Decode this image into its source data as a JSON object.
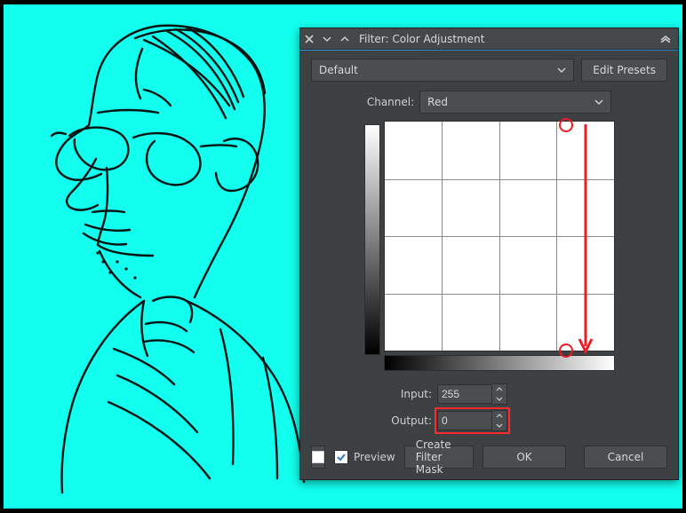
{
  "dialog": {
    "title": "Filter: Color Adjustment",
    "preset": "Default",
    "edit_presets": "Edit Presets",
    "channel_label": "Channel:",
    "channel": "Red",
    "input_label": "Input:",
    "input_value": "255",
    "output_label": "Output:",
    "output_value": "0",
    "preview_label": "Preview",
    "preview_checked": true,
    "create_mask": "Create Filter Mask",
    "ok": "OK",
    "cancel": "Cancel"
  },
  "annotations": {
    "highlight": "output-spinner",
    "arrow": "drag-top-right-handle-to-bottom-right",
    "arrow_color": "#ec1c24"
  },
  "canvas": {
    "background": "#12ffef"
  },
  "colors": {
    "panel_bg": "#3e4143",
    "control_bg": "#4a4e51",
    "border": "#2d2f31",
    "text": "#cfcfcf",
    "accent": "#3091d8"
  }
}
